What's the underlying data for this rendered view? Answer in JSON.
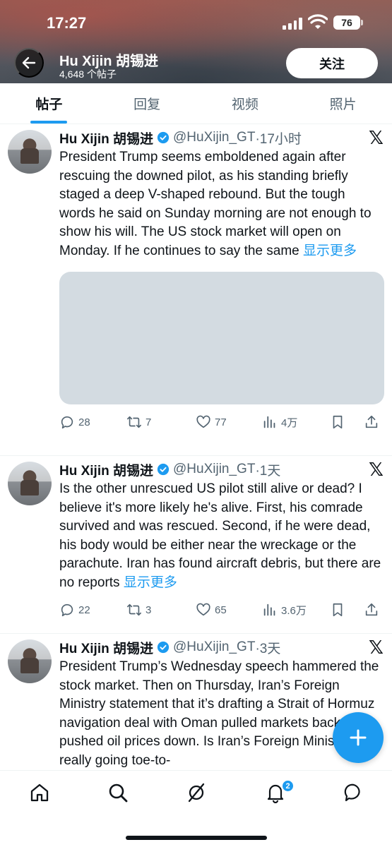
{
  "status_bar": {
    "time": "17:27",
    "battery": "76"
  },
  "header": {
    "name": "Hu Xijin 胡锡进",
    "post_count": "4,648 个帖子",
    "follow_label": "关注"
  },
  "tabs": [
    {
      "label": "帖子",
      "active": true
    },
    {
      "label": "回复",
      "active": false
    },
    {
      "label": "视频",
      "active": false
    },
    {
      "label": "照片",
      "active": false
    }
  ],
  "tweets": [
    {
      "author": "Hu Xijin 胡锡进",
      "handle": "@HuXijin_GT",
      "time": "·17小时",
      "text": "President Trump seems emboldened again after rescuing the downed pilot, as his standing briefly staged a deep V-shaped rebound. But the tough words he said on Sunday morning are not enough to show his will. The US stock market will open on Monday. If he continues to say the same",
      "show_more": "显示更多",
      "replies": "28",
      "retweets": "7",
      "likes": "77",
      "views": "4万"
    },
    {
      "author": "Hu Xijin 胡锡进",
      "handle": "@HuXijin_GT",
      "time": "·1天",
      "text": "Is the other unrescued US pilot still alive or dead? I believe it's more likely he's alive. First, his comrade survived and was rescued. Second, if he were dead, his body would be either near the wreckage or the parachute. Iran has found aircraft debris, but there are no reports",
      "show_more": "显示更多",
      "replies": "22",
      "retweets": "3",
      "likes": "65",
      "views": "3.6万"
    },
    {
      "author": "Hu Xijin 胡锡进",
      "handle": "@HuXijin_GT",
      "time": "·3天",
      "text": "President Trump’s Wednesday speech hammered the stock market. Then on Thursday, Iran’s Foreign Ministry statement that it’s drafting a Strait of Hormuz navigation deal with Oman pulled markets back and pushed oil prices down. Is Iran’s Foreign Ministry really going toe-to-",
      "show_more": "",
      "replies": "",
      "retweets": "",
      "likes": "",
      "views": ""
    }
  ],
  "bottom_nav": {
    "notifications_badge": "2"
  },
  "icons": {
    "back": "arrow-left-icon",
    "verified": "verified-badge-icon",
    "x_logo": "x-logo-icon",
    "compose": "plus-icon"
  },
  "colors": {
    "accent": "#1d9bf0",
    "text": "#0f1419",
    "muted": "#536471"
  }
}
